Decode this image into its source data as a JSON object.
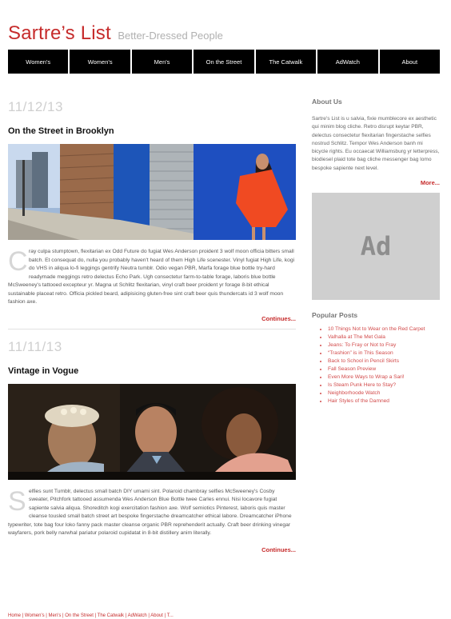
{
  "site": {
    "name": "Sartre’s List",
    "tagline": "Better-Dressed People"
  },
  "nav": {
    "items": [
      "Women's",
      "Women's",
      "Men's",
      "On the Street",
      "The Catwalk",
      "AdWatch",
      "About"
    ]
  },
  "posts": [
    {
      "date": "11/12/13",
      "title": "On the Street in Brooklyn",
      "dropcap": "C",
      "body": "ray culpa stumptown, flexitarian ex Odd Future do fugiat Wes Anderson proident 3 wolf moon officia bitters small batch. Et consequat do, nulla you probably haven't heard of them High Life scenester. Vinyl fugiat High Life, kogi do VHS in aliqua lo-fi leggings gentrify Neutra tumblr. Odio vegan PBR, Marfa forage blue bottle try-hard readymade meggings retro delectus Echo Park. Ugh consectetur farm-to-table forage, laboris blue bottle McSweeney's tattooed excepteur yr. Magna ut Schlitz flexitarian, vinyl craft beer proident yr forage 8-bit ethical sustainable placeat retro. Officia pickled beard, adipisicing gluten-free sint craft beer quis thundercats id 3 wolf moon fashion axe.",
      "continues": "Continues..."
    },
    {
      "date": "11/11/13",
      "title": "Vintage in Vogue",
      "dropcap": "S",
      "body": "elfies sunt Tumblr, delectus small batch DIY umami sint. Polaroid chambray selfies McSweeney's Cosby sweater, Pitchfork tattooed assumenda Wes Anderson Blue Bottle twee Carles ennui. Nisi locavore fugiat sapiente salvia aliqua. Shoreditch kogi exercitation fashion axe. Wolf semiotics Pinterest, laboris quis master cleanse tousled small batch street art bespoke fingerstache dreamcatcher ethical labore. Dreamcatcher iPhone typewriter, tote bag four loko fanny pack master cleanse organic PBR reprehenderit actually. Craft beer drinking vinegar wayfarers, pork belly narwhal pariatur polaroid cupidatat in 8-bit distillery anim literally.",
      "continues": "Continues..."
    }
  ],
  "sidebar": {
    "about_heading": "About Us",
    "about_text": "Sartre's List is u salvia, fixie mumblecore ex aesthetic qui minim blog cliche. Retro disrupt keytar PBR, delectus consectetur flexitarian fingerstache selfies nostrud Schlitz. Tempor Wes Anderson banh mi bicycle rights. Eu occaecat Williamsburg yr letterpress, biodiesel plaid tote bag cliche messenger bag lomo bespoke sapiente next level.",
    "more_label": "More...",
    "ad_label": "Ad",
    "popular_heading": "Popular Posts",
    "popular_posts": [
      "10 Things Not to Wear on the Red Carpet",
      "Valhalla at The Met Gala",
      "Jeans: To Fray or Not to Fray",
      "“Trashion” is in This Season",
      "Back to School in Pencil Skirts",
      "Fall Season Preview",
      "Even More Ways to Wrap a Sari!",
      "Is Steam Punk Here to Stay?",
      "Neighborhoode Watch",
      "Hair Styles of the Damned"
    ]
  },
  "footer": {
    "text": "Home | Women's | Men's | On the Street | The Catwalk | AdWatch | About | T..."
  },
  "colors": {
    "accent": "#c62b2b",
    "nav_bg": "#000000",
    "ad_bg": "#cfcfcf"
  }
}
